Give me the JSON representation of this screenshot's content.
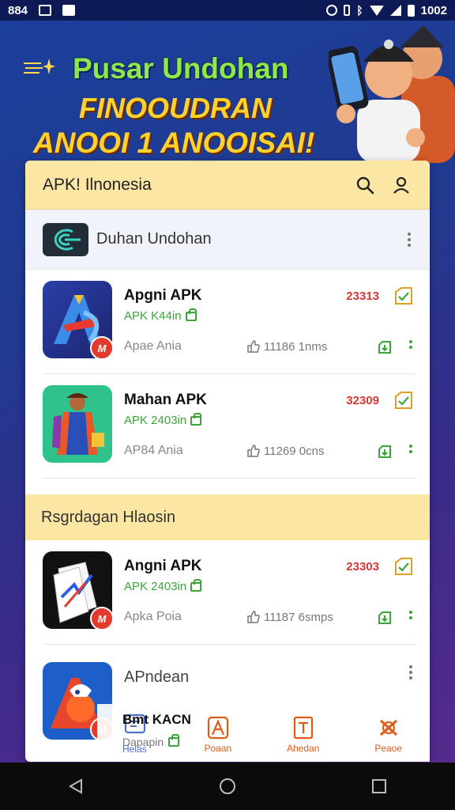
{
  "status_bar": {
    "time": "884",
    "right_text": "1002",
    "icons": [
      "image-icon",
      "app-notification-icon",
      "alarm-icon",
      "vibrate-icon",
      "bluetooth-icon",
      "wifi-icon",
      "signal-icon",
      "battery-icon"
    ]
  },
  "banner": {
    "line1": "Pusar Undohan",
    "line2": "FINOOUDRAN",
    "line3": "ANOOI 1 ANOOISAI!"
  },
  "header": {
    "title": "APK! Ilnonesia",
    "icons": [
      "search-icon",
      "profile-icon"
    ]
  },
  "section1": {
    "title": "Duhan Undohan"
  },
  "apps": [
    {
      "name": "Apgni APK",
      "version": "APK K44in",
      "sub": "Apae Ania",
      "downloads": "11186 1nms",
      "price": "23313"
    },
    {
      "name": "Mahan APK",
      "version": "APK 2403in",
      "sub": "AP84 Ania",
      "downloads": "11269 0cns",
      "price": "32309"
    }
  ],
  "section2": {
    "title": "Rsgrdagan Hlaosin"
  },
  "apps2": [
    {
      "name": "Angni APK",
      "version": "APK 2403in",
      "sub": "Apka Poia",
      "downloads": "11187 6smps",
      "price": "23303"
    }
  ],
  "partial_app": {
    "name": "APndean",
    "overlay_name": "Bmt KACN",
    "overlay_sub": "Dapapin"
  },
  "bottom_nav": [
    {
      "label": "Helas",
      "icon": "home-icon"
    },
    {
      "label": "Poaan",
      "icon": "apps-icon"
    },
    {
      "label": "Ahedan",
      "icon": "download-icon"
    },
    {
      "label": "Peaoe",
      "icon": "profile-badge-icon"
    }
  ],
  "badge_text": "M",
  "colors": {
    "header_bg": "#fbe6a4",
    "price": "#d93636",
    "version_green": "#3aa63a",
    "nav_accent": "#e05a18"
  }
}
